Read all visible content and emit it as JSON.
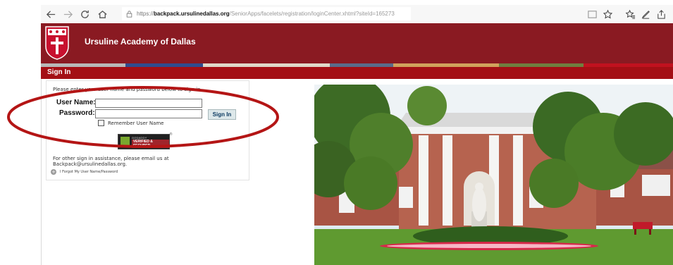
{
  "browser": {
    "url_host": "backpack.ursulinedallas.org",
    "url_prefix": "https://",
    "url_path": "/SeniorApps/facelets/registration/loginCenter.xhtml?siteId=165273"
  },
  "site": {
    "name": "Ursuline Academy of Dallas",
    "signin_title": "Sign In",
    "colors": {
      "header": "#8a1a22",
      "signin_bar": "#a40f15",
      "stripe": [
        "#b8b8b8",
        "#2f4c8f",
        "#e0d8c9",
        "#5a6b8a",
        "#d1a25c",
        "#6f7f3f",
        "#c1121f"
      ]
    }
  },
  "login": {
    "instructions": "Please enter your user name and password below to sign in.",
    "username_label": "User Name:",
    "password_label": "Password:",
    "username_value": "",
    "password_value": "",
    "signin_button": "Sign In",
    "remember_label": "Remember User Name",
    "remember_checked": false,
    "seal_line1": "GODADDY",
    "seal_line2": "VERIFIED & SECURED",
    "seal_reg": "®",
    "help_text_1": "For other sign in assistance, please email us at",
    "help_text_2": "Backpack@ursulinedallas.org.",
    "forgot_link": "I Forgot My User Name/Password"
  },
  "icons": {
    "back": "arrow-left-icon",
    "forward": "arrow-right-icon",
    "refresh": "refresh-icon",
    "home": "home-icon",
    "lock": "lock-icon",
    "reading": "reading-view-icon",
    "favorite": "star-icon",
    "favorites": "favorites-icon",
    "notes": "pen-icon",
    "share": "share-icon",
    "plus": "plus-icon"
  },
  "annotation": {
    "color": "#b41515"
  }
}
